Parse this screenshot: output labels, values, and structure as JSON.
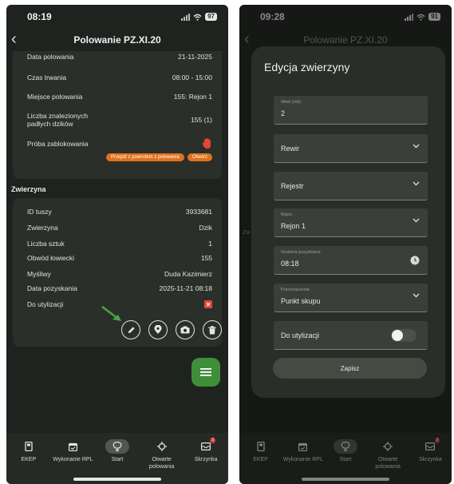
{
  "left": {
    "status_time": "08:19",
    "battery": "97",
    "title": "Polowanie PZ.XI.20",
    "hunt_rows": [
      {
        "label": "Data polowania",
        "value": "21-11-2025"
      },
      {
        "label": "Czas trwania",
        "value": "08:00 - 15:00"
      },
      {
        "label": "Miejsce polowania",
        "value": "155: Rejon 1"
      },
      {
        "label": "Liczba znalezionych padłych dzików",
        "value": "155 (1)"
      },
      {
        "label": "Próba zablokowania",
        "value": ""
      }
    ],
    "orange_button_1": "Przejdź z powrotem z polowania",
    "orange_button_2": "Otwórz",
    "section_title": "Zwierzyna",
    "game_rows": [
      {
        "label": "ID tuszy",
        "value": "3933681"
      },
      {
        "label": "Zwierzyna",
        "value": "Dzik"
      },
      {
        "label": "Liczba sztuk",
        "value": "1"
      },
      {
        "label": "Obwód łowiecki",
        "value": "155"
      },
      {
        "label": "Myśliwy",
        "value": "Duda Kazimierz"
      },
      {
        "label": "Data pozyskania",
        "value": "2025-11-21 08:18"
      },
      {
        "label": "Do utylizacji",
        "value": ""
      }
    ]
  },
  "right": {
    "status_time": "09:28",
    "battery": "91",
    "title": "Polowanie PZ.XI.20",
    "side_peek": "Zw",
    "dialog_title": "Edycja zwierzyny",
    "fields": {
      "age_label": "Wiek (rok)",
      "age_value": "2",
      "rewir_placeholder": "Rewir",
      "rejestr_placeholder": "Rejestr",
      "rejon_label": "Rejon",
      "rejon_value": "Rejon 1",
      "time_label": "Godzina pozyskania",
      "time_value": "08:18",
      "purpose_label": "Przeznaczenie",
      "purpose_value": "Punkt skupu",
      "disposal_label": "Do utylizacji"
    },
    "save_label": "Zapisz"
  },
  "nav": [
    {
      "label": "EKEP",
      "icon": "book-icon"
    },
    {
      "label": "Wykonanie RPL",
      "icon": "calendar-icon"
    },
    {
      "label": "Start",
      "icon": "tree-icon"
    },
    {
      "label": "Otwarte polowania",
      "icon": "target-icon"
    },
    {
      "label": "Skrzynka",
      "icon": "inbox-icon"
    }
  ],
  "nav_badge": "3",
  "colors": {
    "background": "#1f231f",
    "card": "#2b2f2a",
    "accent_green": "#3f8f3a",
    "accent_orange": "#e0711f",
    "alert_red": "#d6393a",
    "arrow_green": "#3ea84a"
  }
}
